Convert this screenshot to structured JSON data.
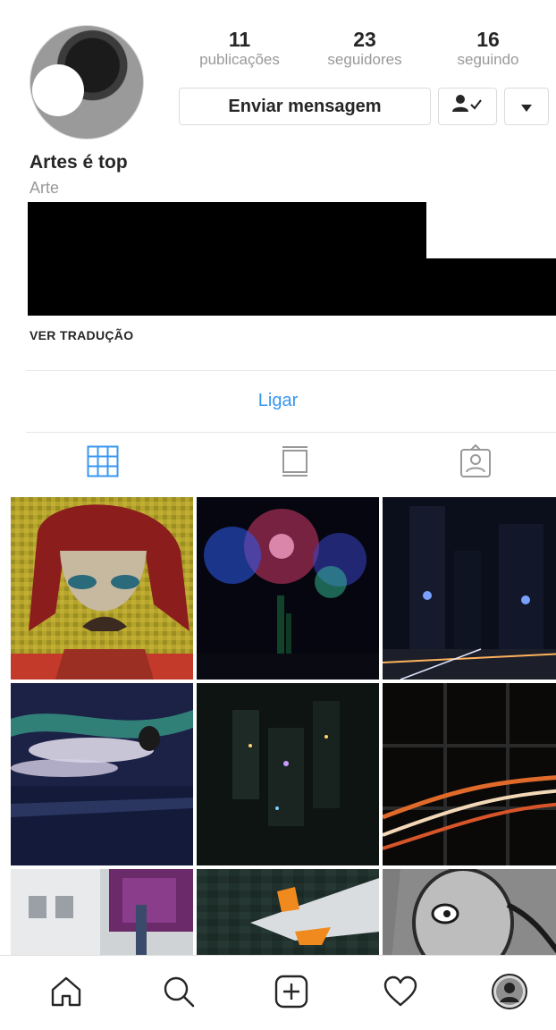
{
  "profile": {
    "name": "Artes é top",
    "category": "Arte",
    "stats": [
      {
        "value": "11",
        "label": "publicações"
      },
      {
        "value": "23",
        "label": "seguidores"
      },
      {
        "value": "16",
        "label": "seguindo"
      }
    ],
    "message_button": "Enviar mensagem",
    "following_button_icon": "person-check-icon",
    "more_button_icon": "triangle-down-icon",
    "see_translation": "VER TRADUÇÃO",
    "call_button": "Ligar"
  },
  "tabs": [
    {
      "name": "grid",
      "icon": "grid-icon",
      "active": true
    },
    {
      "name": "feed",
      "icon": "feed-icon",
      "active": false
    },
    {
      "name": "tagged",
      "icon": "tagged-icon",
      "active": false
    }
  ],
  "posts": [
    {
      "subject": "pop art portrait"
    },
    {
      "subject": "fireworks"
    },
    {
      "subject": "city night street"
    },
    {
      "subject": "aurora balloon sky"
    },
    {
      "subject": "aerial night city"
    },
    {
      "subject": "highway light trails"
    },
    {
      "subject": "street sign"
    },
    {
      "subject": "airplane wing"
    },
    {
      "subject": "sketch portrait"
    }
  ],
  "bottom_nav": [
    {
      "name": "home",
      "icon": "home-icon"
    },
    {
      "name": "search",
      "icon": "search-icon"
    },
    {
      "name": "new-post",
      "icon": "plus-square-icon"
    },
    {
      "name": "activity",
      "icon": "heart-icon"
    },
    {
      "name": "profile",
      "icon": "profile-avatar-icon"
    }
  ],
  "colors": {
    "accent_link": "#3897f0",
    "grid_tab_active": "#3897f0",
    "muted_text": "#999999"
  }
}
